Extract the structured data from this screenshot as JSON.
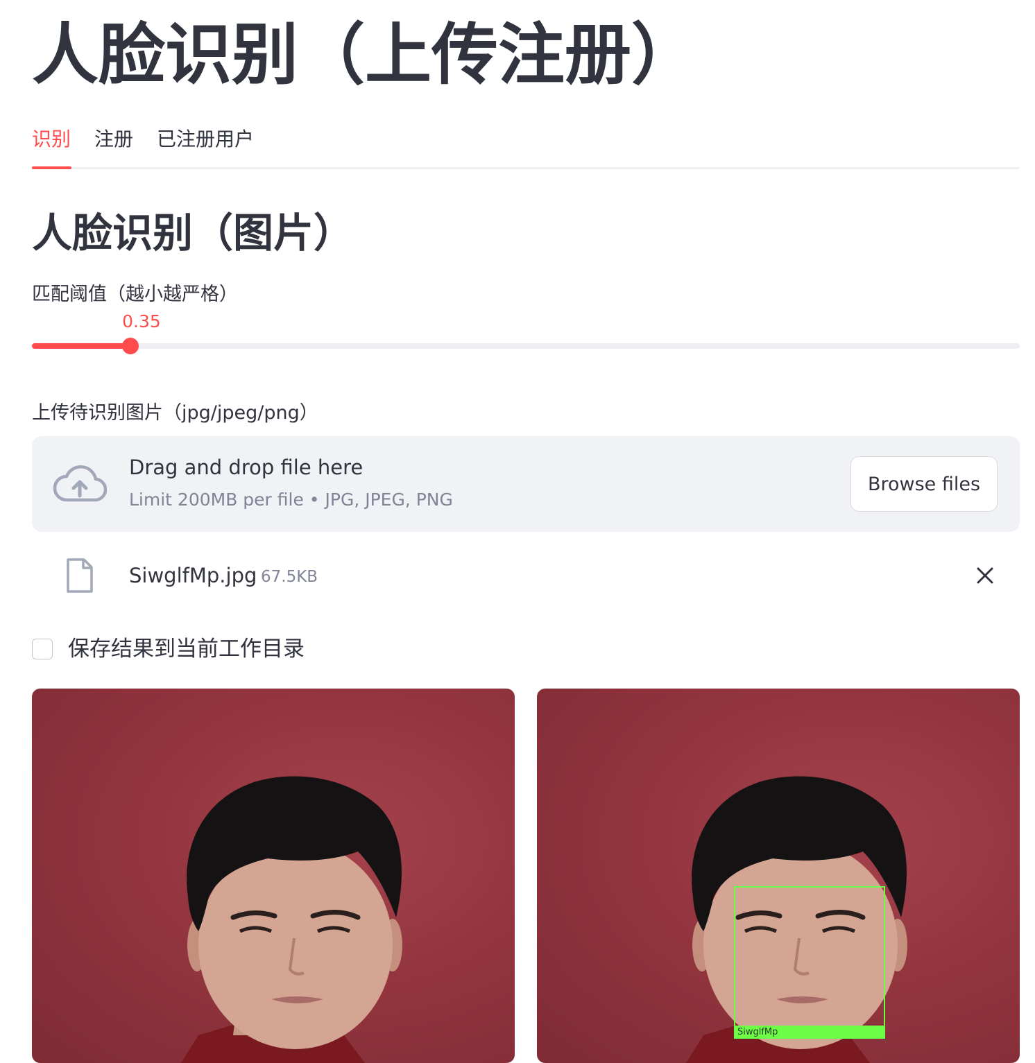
{
  "header": {
    "title": "人脸识别（上传注册）"
  },
  "tabs": [
    {
      "label": "识别",
      "active": true
    },
    {
      "label": "注册",
      "active": false
    },
    {
      "label": "已注册用户",
      "active": false
    }
  ],
  "section": {
    "title": "人脸识别（图片）"
  },
  "slider": {
    "label": "匹配阈值（越小越严格）",
    "value_text": "0.35",
    "fraction": 0.1
  },
  "uploader": {
    "label": "上传待识别图片（jpg/jpeg/png）",
    "drop_title": "Drag and drop file here",
    "drop_hint": "Limit 200MB per file • JPG, JPEG, PNG",
    "browse_label": "Browse files",
    "icon": "cloud-upload-icon"
  },
  "file": {
    "name": "SiwglfMp.jpg",
    "size": "67.5KB",
    "icon": "file-icon",
    "remove_icon": "close-icon"
  },
  "save_checkbox": {
    "label": "保存结果到当前工作目录",
    "checked": false
  },
  "images": {
    "original": {
      "alt": "uploaded face photo"
    },
    "result": {
      "alt": "recognition result",
      "detection_label": "SiwglfMp"
    }
  },
  "colors": {
    "accent": "#ff4b4b",
    "text": "#31333f",
    "muted": "#808495",
    "dropzone_bg": "#f0f2f6",
    "detect_box": "#6dff47",
    "photo_bg": "#93353f"
  }
}
